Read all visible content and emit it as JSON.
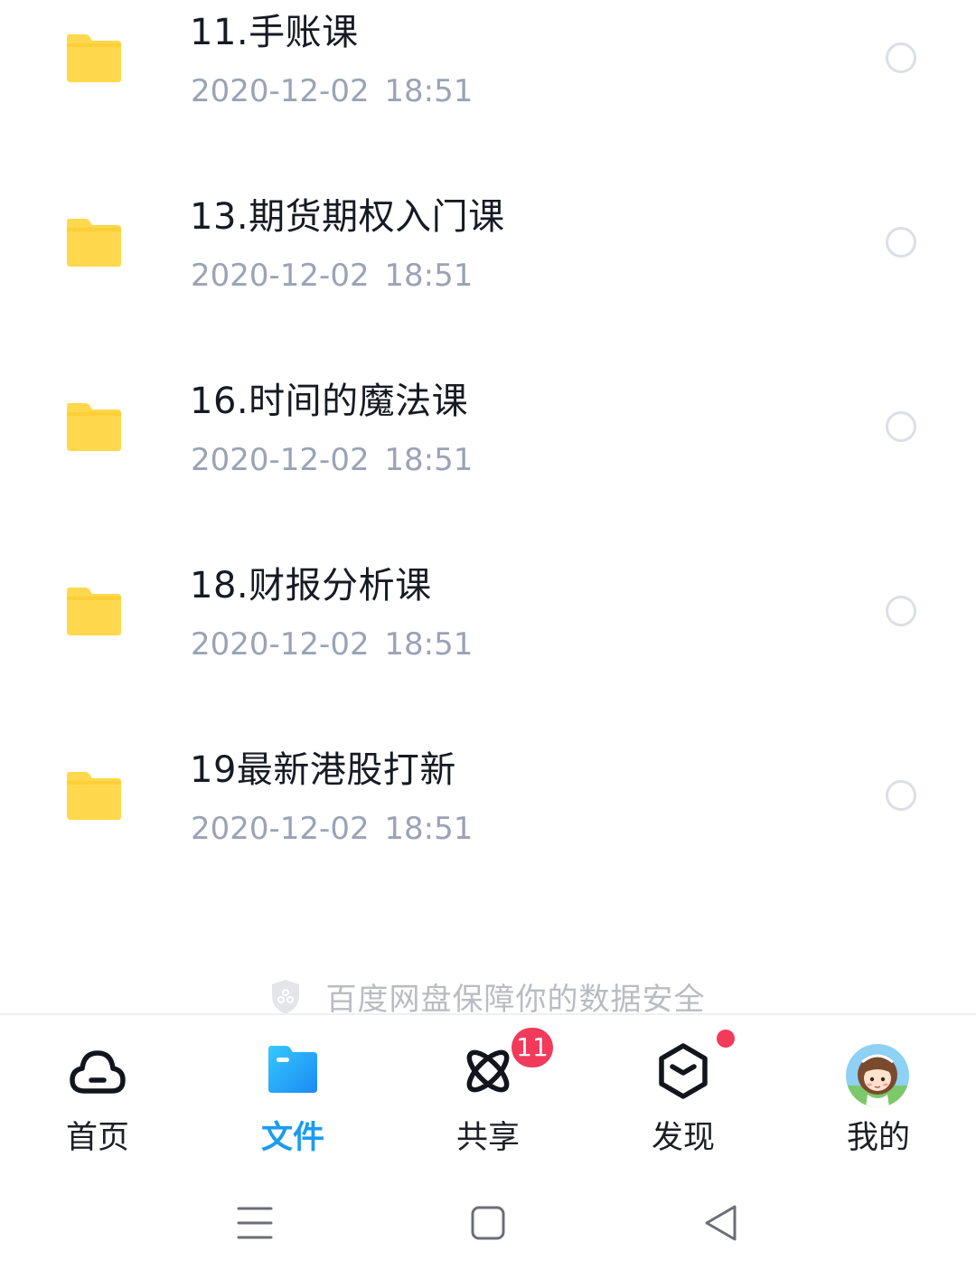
{
  "file_list": [
    {
      "name": "11.手账课",
      "date": "2020-12-02  18:51",
      "icon": "folder-icon"
    },
    {
      "name": "13.期货期权入门课",
      "date": "2020-12-02  18:51",
      "icon": "folder-icon"
    },
    {
      "name": "16.时间的魔法课",
      "date": "2020-12-02  18:51",
      "icon": "folder-icon"
    },
    {
      "name": "18.财报分析课",
      "date": "2020-12-02  18:51",
      "icon": "folder-icon"
    },
    {
      "name": "19最新港股打新",
      "date": "2020-12-02  18:51",
      "icon": "folder-icon"
    }
  ],
  "security_note": {
    "text": "百度网盘保障你的数据安全",
    "icon": "shield-icon"
  },
  "tab_bar": {
    "active": "files",
    "tabs": [
      {
        "id": "home",
        "label": "首页",
        "icon": "cloud-icon"
      },
      {
        "id": "files",
        "label": "文件",
        "icon": "folder-icon"
      },
      {
        "id": "share",
        "label": "共享",
        "icon": "orbit-icon",
        "badge": "11"
      },
      {
        "id": "discover",
        "label": "发现",
        "icon": "cube-icon",
        "dot": true
      },
      {
        "id": "me",
        "label": "我的",
        "icon": "avatar"
      }
    ]
  },
  "colors": {
    "folder": "#ffd84d",
    "active_tab": "#1a9cf0",
    "badge": "#f23a5b",
    "date_text": "#9aa3b6"
  },
  "system_nav": {
    "buttons": [
      "menu-icon",
      "home-square-icon",
      "back-triangle-icon"
    ]
  }
}
